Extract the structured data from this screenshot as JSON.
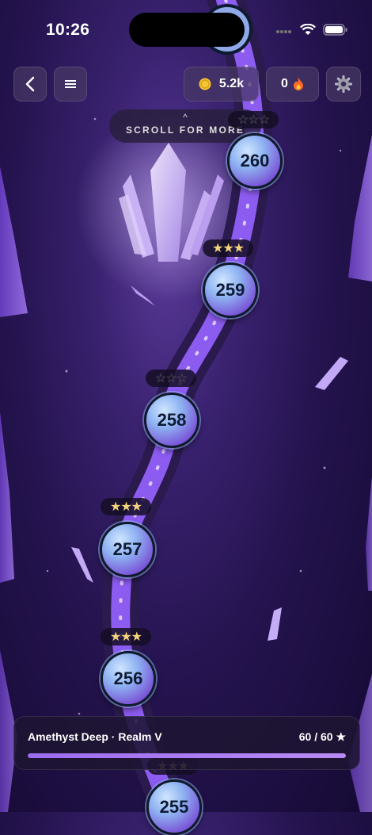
{
  "status_bar": {
    "time": "10:26"
  },
  "top_bar": {
    "coins": "5.2k",
    "streak": "0",
    "colors": {
      "coin": "#f5c533",
      "flame": "#ff6a2b"
    }
  },
  "scroll_hint": {
    "caret": "^",
    "label": "SCROLL FOR MORE"
  },
  "levels": [
    {
      "number": "260",
      "stars": 0
    },
    {
      "number": "259",
      "stars": 3
    },
    {
      "number": "258",
      "stars": 0
    },
    {
      "number": "257",
      "stars": 3
    },
    {
      "number": "256",
      "stars": 3
    },
    {
      "number": "255",
      "stars": 3
    }
  ],
  "footer": {
    "realm": "Amethyst Deep · Realm V",
    "stars_count": "60 / 60 ★",
    "progress": 1.0
  },
  "colors": {
    "path": "#8c5bf0",
    "accent": "#b98bf7"
  }
}
